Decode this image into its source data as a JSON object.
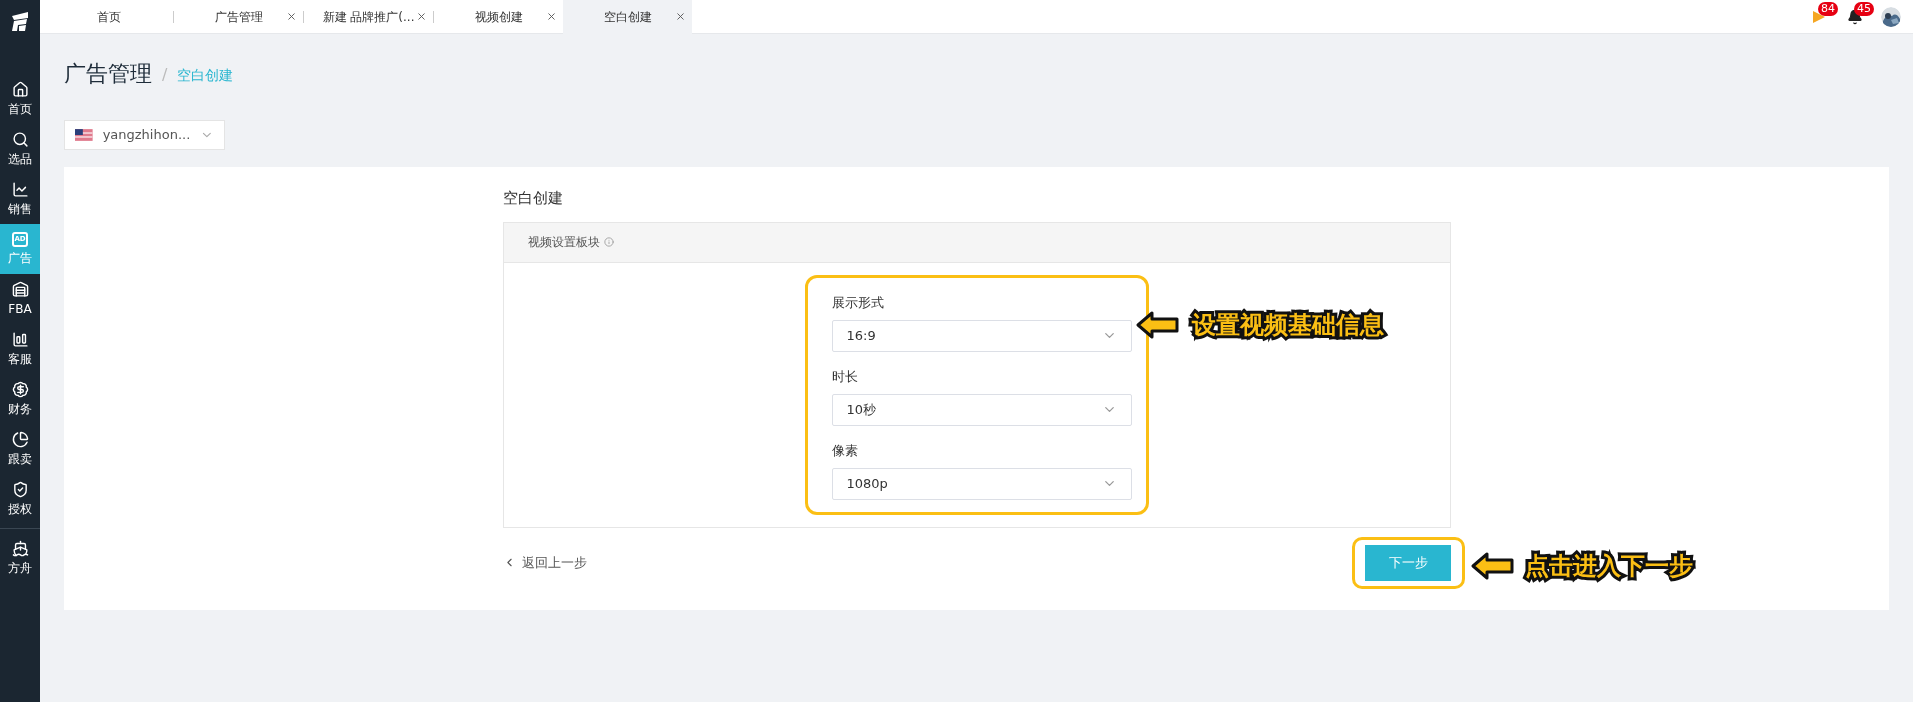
{
  "sidebar": {
    "items": [
      {
        "label": "首页",
        "selected": false
      },
      {
        "label": "选品",
        "selected": false
      },
      {
        "label": "销售",
        "selected": false
      },
      {
        "label": "广告",
        "selected": true,
        "icon_text": "AD"
      },
      {
        "label": "FBA",
        "selected": false
      },
      {
        "label": "客服",
        "selected": false
      },
      {
        "label": "财务",
        "selected": false
      },
      {
        "label": "跟卖",
        "selected": false
      },
      {
        "label": "授权",
        "selected": false
      },
      {
        "label": "方舟",
        "selected": false
      }
    ]
  },
  "tabs": [
    {
      "label": "首页",
      "selected": false,
      "closable": false
    },
    {
      "label": "广告管理",
      "selected": false,
      "closable": true
    },
    {
      "label": "新建 品牌推广(...",
      "selected": false,
      "closable": true
    },
    {
      "label": "视频创建",
      "selected": false,
      "closable": true
    },
    {
      "label": "空白创建",
      "selected": true,
      "closable": true
    }
  ],
  "header_badges": [
    {
      "kind": "flag",
      "count": "84"
    },
    {
      "kind": "bell",
      "count": "45"
    }
  ],
  "breadcrumb": {
    "title": "广告管理",
    "separator": "/",
    "current": "空白创建"
  },
  "account_select": {
    "value": "yangzhihon..."
  },
  "form": {
    "title": "空白创建",
    "section": "视频设置板块",
    "fields": [
      {
        "label": "展示形式",
        "value": "16:9"
      },
      {
        "label": "时长",
        "value": "10秒"
      },
      {
        "label": "像素",
        "value": "1080p"
      }
    ],
    "back_link": "返回上一步",
    "next_button": "下一步"
  },
  "annotations": [
    {
      "text": "设置视频基础信息"
    },
    {
      "text": "点击进入下一步"
    }
  ]
}
